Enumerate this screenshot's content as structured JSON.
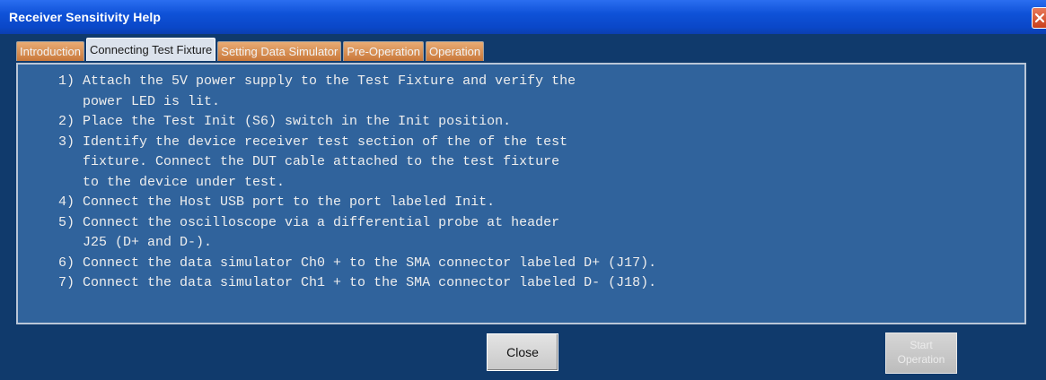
{
  "window": {
    "title": "Receiver Sensitivity Help"
  },
  "tabs": [
    {
      "label": "Introduction",
      "active": false
    },
    {
      "label": "Connecting Test Fixture",
      "active": true
    },
    {
      "label": "Setting Data Simulator",
      "active": false
    },
    {
      "label": "Pre-Operation",
      "active": false
    },
    {
      "label": "Operation",
      "active": false
    }
  ],
  "help_lines": [
    "     1) Attach the 5V power supply to the Test Fixture and verify the",
    "        power LED is lit.",
    "     2) Place the Test Init (S6) switch in the Init position.",
    "     3) Identify the device receiver test section of the of the test",
    "        fixture. Connect the DUT cable attached to the test fixture",
    "        to the device under test.",
    "     4) Connect the Host USB port to the port labeled Init.",
    "     5) Connect the oscilloscope via a differential probe at header",
    "        J25 (D+ and D-).",
    "     6) Connect the data simulator Ch0 + to the SMA connector labeled D+ (J17).",
    "     7) Connect the data simulator Ch1 + to the SMA connector labeled D- (J18)."
  ],
  "buttons": {
    "close_label": "Close",
    "start_label_line1": "Start",
    "start_label_line2": "Operation",
    "start_enabled": false
  },
  "colors": {
    "titlebar": "#0f52d8",
    "content_bg": "#30639c",
    "frame_bg": "#103a6c",
    "inactive_tab": "#d98f52"
  }
}
